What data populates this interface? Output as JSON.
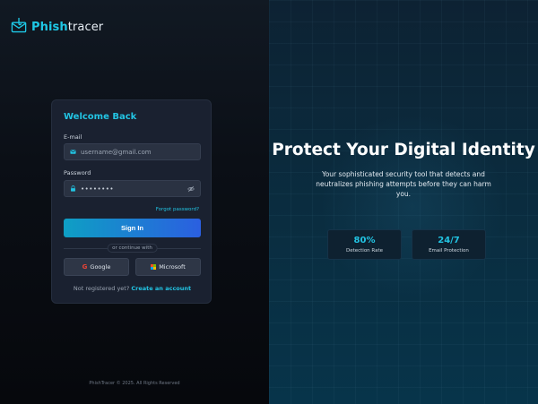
{
  "brand": {
    "name_part1": "Phish",
    "name_part2": "tracer",
    "icon": "mail-hook-logo"
  },
  "login": {
    "title": "Welcome Back",
    "email_label": "E-mail",
    "email_placeholder": "username@gmail.com",
    "password_label": "Password",
    "password_masked": "••••••••",
    "forgot_password": "Forgot password?",
    "sign_in_button": "Sign In",
    "divider_text": "or continue with",
    "google_button": "Google",
    "microsoft_button": "Microsoft",
    "register_prompt": "Not registered yet?",
    "register_link": "Create an account"
  },
  "footer": {
    "copyright": "PhishTracer © 2025. All Rights Reserved"
  },
  "hero": {
    "heading": "Protect Your Digital Identity",
    "description": "Your sophisticated security tool that detects and neutralizes phishing attempts before they can harm you.",
    "stats": [
      {
        "value": "80%",
        "label": "Detection Rate"
      },
      {
        "value": "24/7",
        "label": "Email Protection"
      }
    ]
  },
  "colors": {
    "accent": "#22c4e3",
    "button_gradient_start": "#0e9fc4",
    "button_gradient_end": "#2b5fe0",
    "left_panel_bg": "#0b0f16",
    "right_panel_bg": "#0a2d40",
    "card_bg": "#1a2130"
  }
}
